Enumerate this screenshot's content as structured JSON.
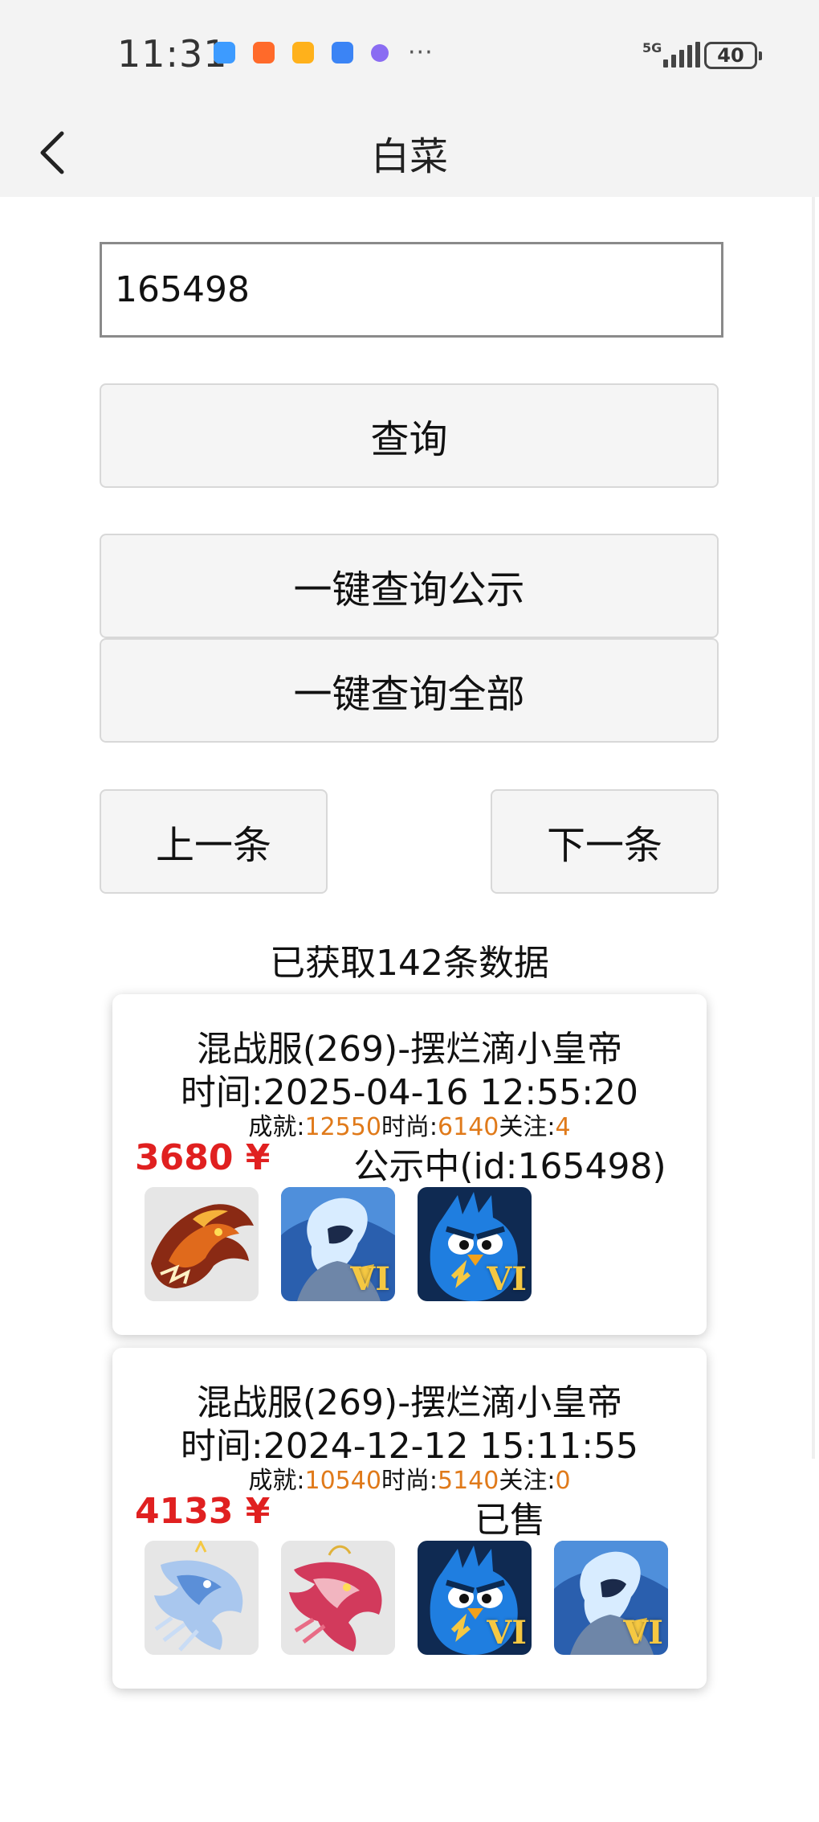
{
  "status_bar": {
    "time": "11:31",
    "more": "···",
    "network": "5G",
    "battery": "40"
  },
  "nav": {
    "title": "白菜",
    "back_icon": "chevron-left-icon"
  },
  "search": {
    "value": "165498",
    "placeholder": ""
  },
  "buttons": {
    "query": "查询",
    "query_public": "一键查询公示",
    "query_all": "一键查询全部",
    "prev": "上一条",
    "next": "下一条"
  },
  "info": {
    "count_text": "已获取142条数据"
  },
  "colors": {
    "price": "#e02020",
    "stat_value": "#e07a1a",
    "vip_badge": "#f5c842"
  },
  "cards": [
    {
      "server": "混战服(269)-摆烂滴小皇帝",
      "time": "时间:2025-04-16 12:55:20",
      "stats": {
        "achievement_label": "成就:",
        "achievement_value": "12550",
        "fashion_label": "时尚:",
        "fashion_value": "6140",
        "follow_label": "关注:",
        "follow_value": "4"
      },
      "price": "3680 ¥",
      "status": "公示中(id:165498)",
      "thumbs": [
        {
          "icon": "fire-dragon-icon",
          "badge": ""
        },
        {
          "icon": "ice-warrior-icon",
          "badge": "VI"
        },
        {
          "icon": "blue-bird-icon",
          "badge": "VI"
        }
      ]
    },
    {
      "server": "混战服(269)-摆烂滴小皇帝",
      "time": "时间:2024-12-12 15:11:55",
      "stats": {
        "achievement_label": "成就:",
        "achievement_value": "10540",
        "fashion_label": "时尚:",
        "fashion_value": "5140",
        "follow_label": "关注:",
        "follow_value": "0"
      },
      "price": "4133 ¥",
      "status": "已售",
      "thumbs": [
        {
          "icon": "ice-dragon-icon",
          "badge": ""
        },
        {
          "icon": "red-dragon-icon",
          "badge": ""
        },
        {
          "icon": "blue-bird-icon",
          "badge": "VI"
        },
        {
          "icon": "ice-warrior-icon",
          "badge": "VI"
        }
      ]
    }
  ]
}
